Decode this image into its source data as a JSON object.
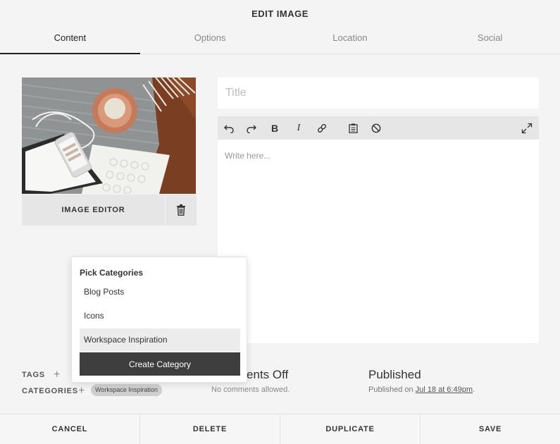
{
  "header": {
    "title": "EDIT IMAGE"
  },
  "tabs": [
    {
      "label": "Content",
      "active": true
    },
    {
      "label": "Options",
      "active": false
    },
    {
      "label": "Location",
      "active": false
    },
    {
      "label": "Social",
      "active": false
    }
  ],
  "image": {
    "editor_label": "IMAGE EDITOR",
    "trash_icon": "trash-icon"
  },
  "editor": {
    "title_placeholder": "Title",
    "title_value": "",
    "body_placeholder": "Write here...",
    "toolbar_icons": [
      "undo-icon",
      "redo-icon",
      "bold-icon",
      "italic-icon",
      "link-icon",
      "clipboard-icon",
      "clear-format-icon",
      "expand-icon"
    ]
  },
  "meta": {
    "tags_label": "TAGS",
    "categories_label": "CATEGORIES",
    "selected_category": "Workspace Inspiration",
    "comments_title": "Comments Off",
    "comments_sub": "No comments allowed.",
    "published_title": "Published",
    "published_prefix": "Published on ",
    "published_date": "Jul 18 at 6:49pm",
    "published_suffix": "."
  },
  "dropdown": {
    "title": "Pick Categories",
    "items": [
      {
        "label": "Blog Posts",
        "selected": false
      },
      {
        "label": "Icons",
        "selected": false
      },
      {
        "label": "Workspace Inspiration",
        "selected": true
      }
    ],
    "create_label": "Create Category"
  },
  "footer": {
    "cancel": "CANCEL",
    "delete": "DELETE",
    "duplicate": "DUPLICATE",
    "save": "SAVE"
  },
  "colors": {
    "background": "#f4f4f4",
    "panel": "#ffffff",
    "toolbar": "#e6e6e6",
    "dark_button": "#3e3e3e"
  }
}
